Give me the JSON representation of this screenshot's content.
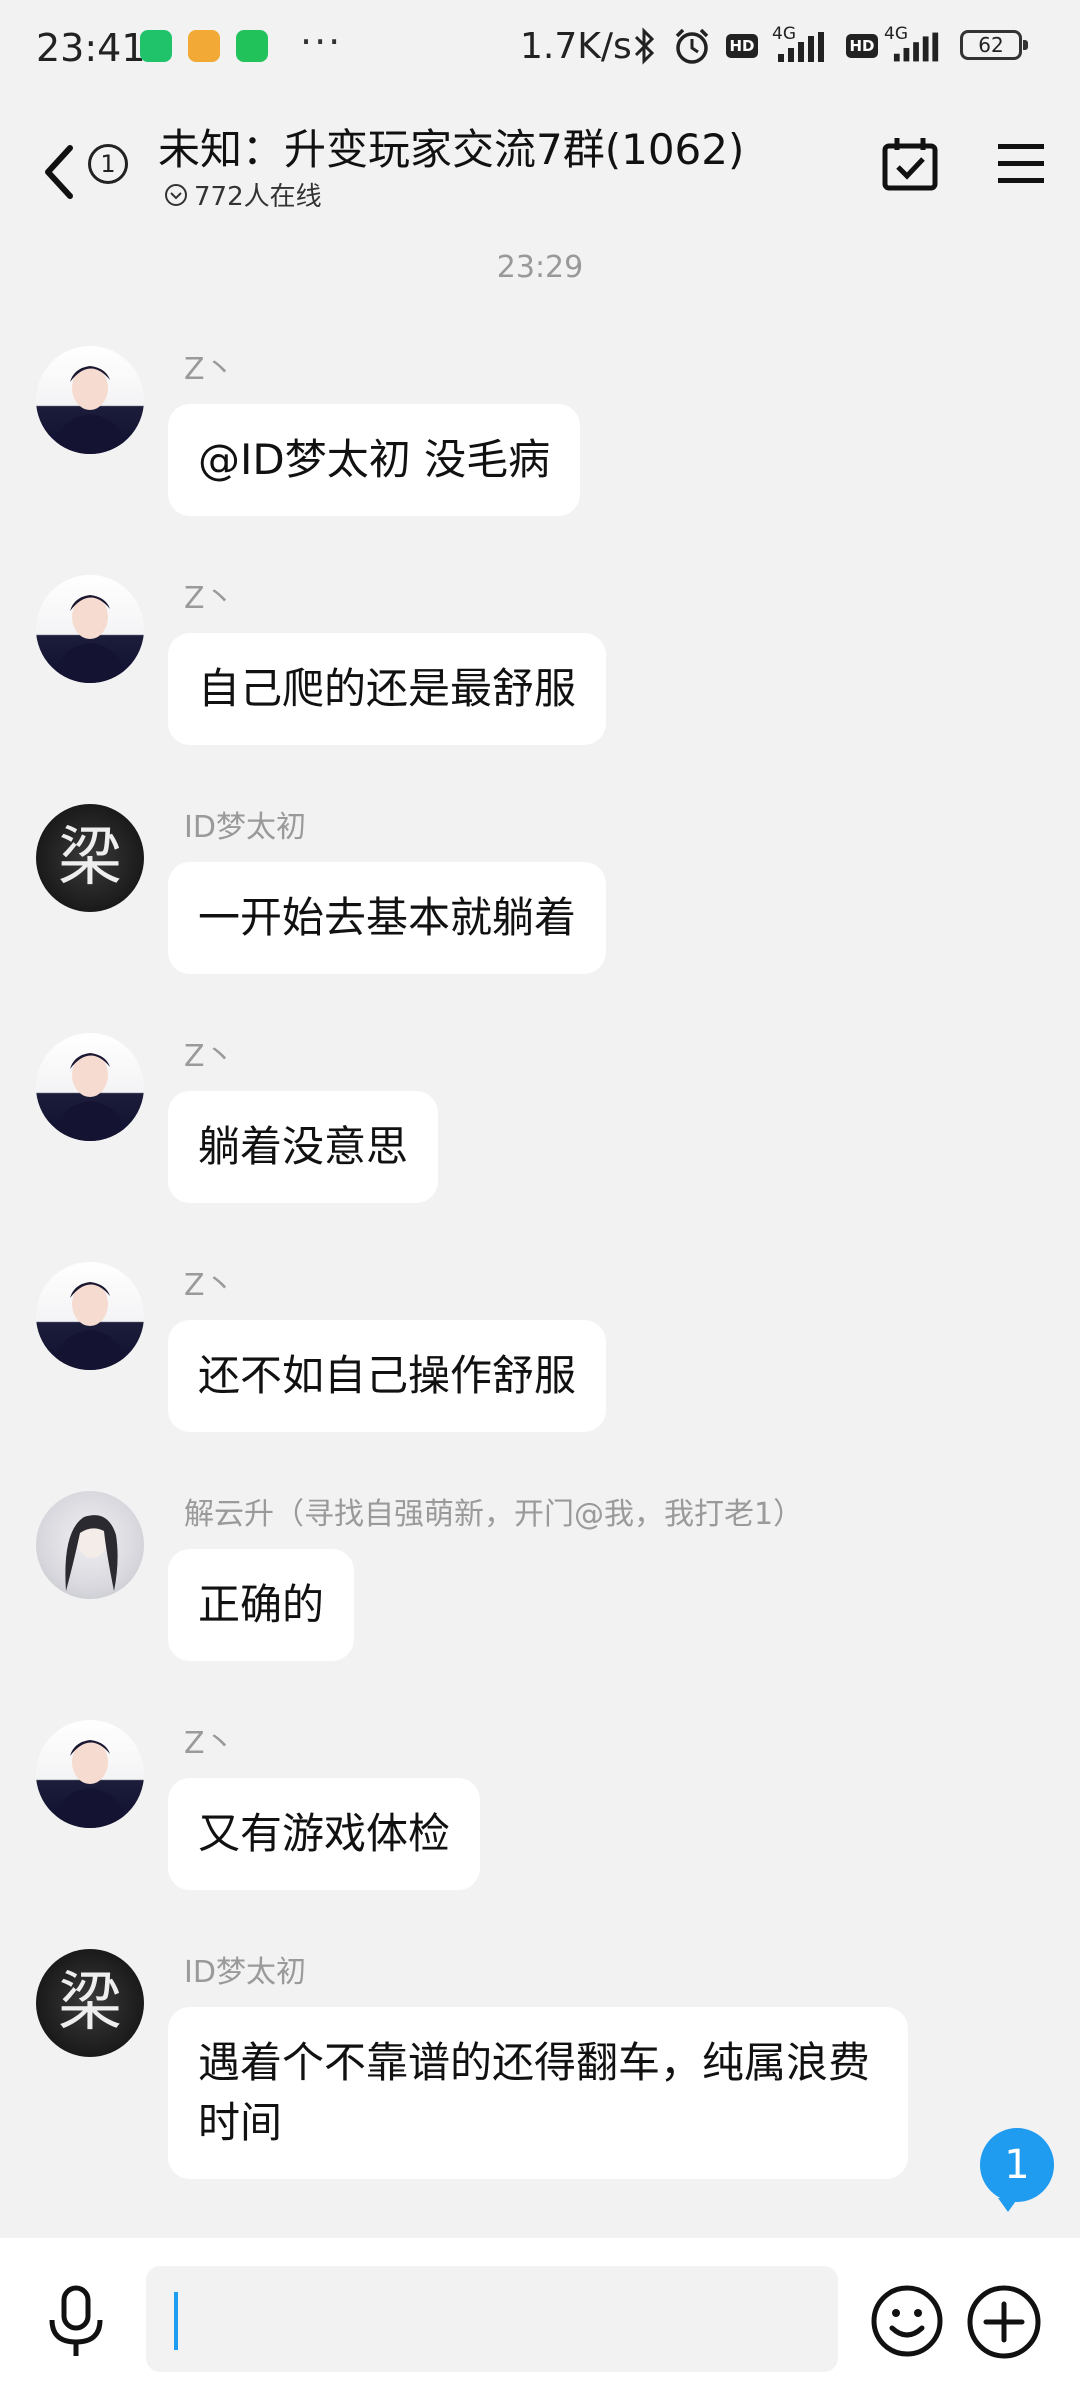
{
  "status_bar": {
    "time": "23:41",
    "dots": "···",
    "net_speed": "1.7K/s",
    "hd1": "HD",
    "net1": "4G",
    "hd2": "HD",
    "net2": "4G",
    "battery": "62"
  },
  "header": {
    "unread_count": "1",
    "title": "未知：升变玩家交流7群(1062)",
    "online_text": "772人在线"
  },
  "chat": {
    "timestamp": "23:29",
    "messages": [
      {
        "sender": "Z丶",
        "text": "@ID梦太初 没毛病",
        "avatar": "boy-avatar"
      },
      {
        "sender": "Z丶",
        "text": "自己爬的还是最舒服",
        "avatar": "boy-avatar"
      },
      {
        "sender": "ID梦太初",
        "text": "一开始去基本就躺着",
        "avatar": "liang-calligraphy-avatar"
      },
      {
        "sender": "Z丶",
        "text": "躺着没意思",
        "avatar": "boy-avatar"
      },
      {
        "sender": "Z丶",
        "text": "还不如自己操作舒服",
        "avatar": "boy-avatar"
      },
      {
        "sender": "解云升（寻找自强萌新，开门@我，我打老1）",
        "text": "正确的",
        "avatar": "girl-avatar"
      },
      {
        "sender": "Z丶",
        "text": "又有游戏体检",
        "avatar": "boy-avatar"
      },
      {
        "sender": "ID梦太初",
        "text": "遇着个不靠谱的还得翻车，纯属浪费时间",
        "avatar": "liang-calligraphy-avatar"
      }
    ],
    "new_message_badge": "1",
    "liang_glyph": "梁"
  },
  "input": {
    "value": "",
    "placeholder": ""
  },
  "colors": {
    "accent": "#1f9bf0",
    "background": "#f2f2f2",
    "bubble": "#ffffff",
    "meta_text": "#9a9a9a"
  },
  "icons": [
    "back-chevron-icon",
    "calendar-check-icon",
    "menu-icon",
    "microphone-icon",
    "emoji-icon",
    "plus-icon",
    "bluetooth-icon",
    "alarm-icon",
    "signal-icon"
  ]
}
